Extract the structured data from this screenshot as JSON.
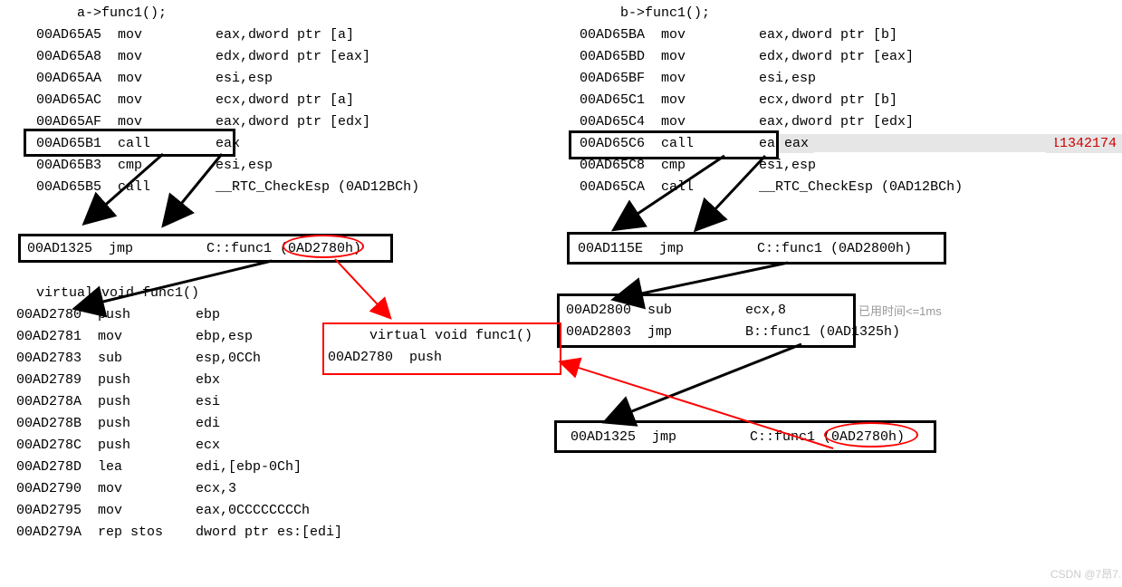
{
  "left": {
    "title": "a->func1();",
    "lines": [
      "00AD65A5  mov         eax,dword ptr [a]",
      "00AD65A8  mov         edx,dword ptr [eax]",
      "00AD65AA  mov         esi,esp",
      "00AD65AC  mov         ecx,dword ptr [a]",
      "00AD65AF  mov         eax,dword ptr [edx]",
      "00AD65B1  call        eax",
      "00AD65B3  cmp         esi,esp",
      "00AD65B5  call        __RTC_CheckEsp (0AD12BCh)"
    ],
    "jmp1": "00AD1325  jmp         C::func1 (0AD2780h)",
    "virt_title": "virtual void func1()",
    "body": [
      "00AD2780  push        ebp",
      "00AD2781  mov         ebp,esp",
      "00AD2783  sub         esp,0CCh",
      "00AD2789  push        ebx",
      "00AD278A  push        esi",
      "00AD278B  push        edi",
      "00AD278C  push        ecx",
      "00AD278D  lea         edi,[ebp-0Ch]",
      "00AD2790  mov         ecx,3",
      "00AD2795  mov         eax,0CCCCCCCCh",
      "00AD279A  rep stos    dword ptr es:[edi]"
    ]
  },
  "right": {
    "title": "b->func1();",
    "lines": [
      "00AD65BA  mov         eax,dword ptr [b]",
      "00AD65BD  mov         edx,dword ptr [eax]",
      "00AD65BF  mov         esi,esp",
      "00AD65C1  mov         ecx,dword ptr [b]",
      "00AD65C4  mov         eax,dword ptr [edx]",
      "00AD65C6  call        eax",
      "00AD65C8  cmp         esi,esp",
      "00AD65CA  call        __RTC_CheckEsp (0AD12BCh)"
    ],
    "tooltip_label": "eax",
    "tooltip_value": "11342174",
    "jmp1": "00AD115E  jmp         C::func1 (0AD2800h)",
    "sub": "00AD2800  sub         ecx,8",
    "jmp2": "00AD2803  jmp         B::func1 (0AD1325h)",
    "jmp3": "00AD1325  jmp         C::func1 (0AD2780h)"
  },
  "center": {
    "virt_title": "virtual void func1()",
    "push": "00AD2780  push"
  },
  "timing": "已用时间<=1ms",
  "watermark": "CSDN @7昂7."
}
